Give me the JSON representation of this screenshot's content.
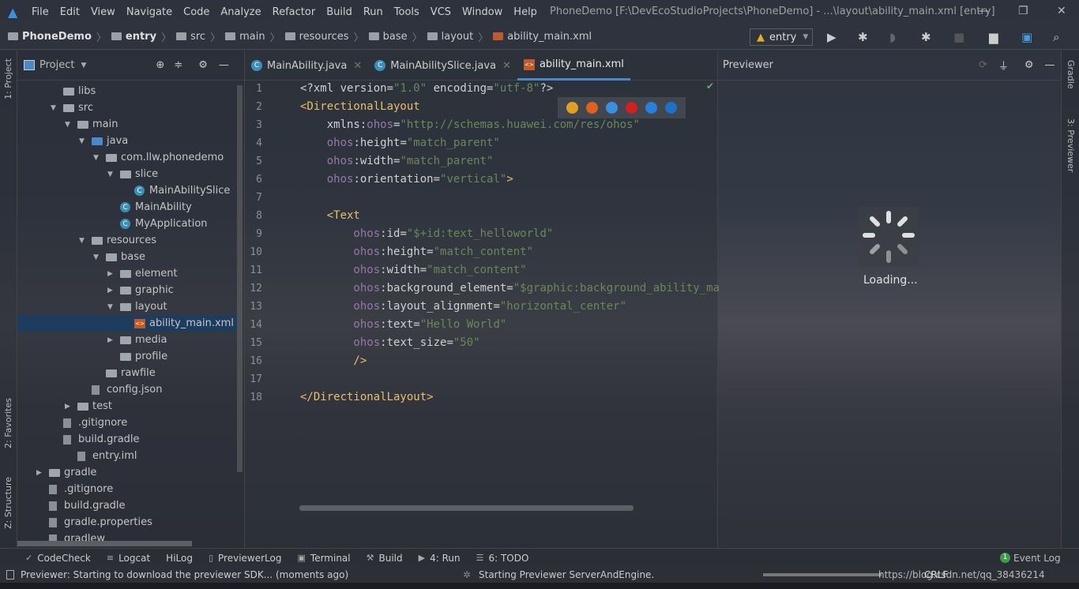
{
  "menu": {
    "items": [
      "File",
      "Edit",
      "View",
      "Navigate",
      "Code",
      "Analyze",
      "Refactor",
      "Build",
      "Run",
      "Tools",
      "VCS",
      "Window",
      "Help"
    ],
    "window_title": "PhoneDemo [F:\\DevEcoStudioProjects\\PhoneDemo] - ...\\layout\\ability_main.xml [entry]"
  },
  "breadcrumb": [
    "PhoneDemo",
    "entry",
    "src",
    "main",
    "resources",
    "base",
    "layout",
    "ability_main.xml"
  ],
  "toolbar": {
    "run_config": "entry"
  },
  "left_strip": {
    "project": "1: Project",
    "favorites": "2: Favorites",
    "structure": "Z: Structure"
  },
  "right_strip": {
    "gradle": "Gradle",
    "previewer": "3: Previewer"
  },
  "project_panel": {
    "title": "Project",
    "tree": [
      {
        "label": "libs",
        "indent": 80,
        "arrow": "",
        "icon": "folder"
      },
      {
        "label": "src",
        "indent": 80,
        "arrow": "down",
        "icon": "folder"
      },
      {
        "label": "main",
        "indent": 98,
        "arrow": "down",
        "icon": "folder"
      },
      {
        "label": "java",
        "indent": 116,
        "arrow": "down",
        "icon": "folder-blue"
      },
      {
        "label": "com.llw.phonedemo",
        "indent": 134,
        "arrow": "down",
        "icon": "folder"
      },
      {
        "label": "slice",
        "indent": 152,
        "arrow": "down",
        "icon": "folder"
      },
      {
        "label": "MainAbilitySlice",
        "indent": 170,
        "arrow": "",
        "icon": "class"
      },
      {
        "label": "MainAbility",
        "indent": 152,
        "arrow": "",
        "icon": "class"
      },
      {
        "label": "MyApplication",
        "indent": 152,
        "arrow": "",
        "icon": "class"
      },
      {
        "label": "resources",
        "indent": 116,
        "arrow": "down",
        "icon": "folder"
      },
      {
        "label": "base",
        "indent": 134,
        "arrow": "down",
        "icon": "folder"
      },
      {
        "label": "element",
        "indent": 152,
        "arrow": "right",
        "icon": "folder"
      },
      {
        "label": "graphic",
        "indent": 152,
        "arrow": "right",
        "icon": "folder"
      },
      {
        "label": "layout",
        "indent": 152,
        "arrow": "down",
        "icon": "folder"
      },
      {
        "label": "ability_main.xml",
        "indent": 170,
        "arrow": "",
        "icon": "xml",
        "selected": true
      },
      {
        "label": "media",
        "indent": 152,
        "arrow": "right",
        "icon": "folder"
      },
      {
        "label": "profile",
        "indent": 152,
        "arrow": "",
        "icon": "folder"
      },
      {
        "label": "rawfile",
        "indent": 134,
        "arrow": "",
        "icon": "folder"
      },
      {
        "label": "config.json",
        "indent": 116,
        "arrow": "",
        "icon": "file"
      },
      {
        "label": "test",
        "indent": 98,
        "arrow": "right",
        "icon": "folder"
      },
      {
        "label": ".gitignore",
        "indent": 80,
        "arrow": "",
        "icon": "file"
      },
      {
        "label": "build.gradle",
        "indent": 80,
        "arrow": "",
        "icon": "gradle"
      },
      {
        "label": "entry.iml",
        "indent": 98,
        "arrow": "",
        "icon": "file"
      },
      {
        "label": "gradle",
        "indent": 62,
        "arrow": "right",
        "icon": "folder"
      },
      {
        "label": ".gitignore",
        "indent": 62,
        "arrow": "",
        "icon": "file"
      },
      {
        "label": "build.gradle",
        "indent": 62,
        "arrow": "",
        "icon": "gradle"
      },
      {
        "label": "gradle.properties",
        "indent": 62,
        "arrow": "",
        "icon": "file"
      },
      {
        "label": "gradlew",
        "indent": 62,
        "arrow": "",
        "icon": "file"
      }
    ]
  },
  "editor": {
    "tabs": [
      {
        "label": "MainAbility.java",
        "icon": "class"
      },
      {
        "label": "MainAbilitySlice.java",
        "icon": "class"
      },
      {
        "label": "ability_main.xml",
        "icon": "xml",
        "active": true
      }
    ],
    "lines": [
      [
        [
          "pi",
          "<?xml version="
        ],
        [
          "val",
          "\"1.0\""
        ],
        [
          "pi",
          " encoding="
        ],
        [
          "val",
          "\"utf-8\""
        ],
        [
          "pi",
          "?>"
        ]
      ],
      [
        [
          "tag",
          "<DirectionalLayout"
        ]
      ],
      [
        [
          "at",
          "    xmlns:"
        ],
        [
          "ns",
          "ohos"
        ],
        [
          "at",
          "="
        ],
        [
          "val",
          "\"http://schemas.huawei.com/res/ohos\""
        ]
      ],
      [
        [
          "ns",
          "    ohos"
        ],
        [
          "at",
          ":height="
        ],
        [
          "val",
          "\"match_parent\""
        ]
      ],
      [
        [
          "ns",
          "    ohos"
        ],
        [
          "at",
          ":width="
        ],
        [
          "val",
          "\"match_parent\""
        ]
      ],
      [
        [
          "ns",
          "    ohos"
        ],
        [
          "at",
          ":orientation="
        ],
        [
          "val",
          "\"vertical\""
        ],
        [
          "tag",
          ">"
        ]
      ],
      [],
      [
        [
          "tag",
          "    <Text"
        ]
      ],
      [
        [
          "ns",
          "        ohos"
        ],
        [
          "at",
          ":id="
        ],
        [
          "val",
          "\"$+id:text_helloworld\""
        ]
      ],
      [
        [
          "ns",
          "        ohos"
        ],
        [
          "at",
          ":height="
        ],
        [
          "val",
          "\"match_content\""
        ]
      ],
      [
        [
          "ns",
          "        ohos"
        ],
        [
          "at",
          ":width="
        ],
        [
          "val",
          "\"match_content\""
        ]
      ],
      [
        [
          "ns",
          "        ohos"
        ],
        [
          "at",
          ":background_element="
        ],
        [
          "val",
          "\"$graphic:background_ability_main\""
        ]
      ],
      [
        [
          "ns",
          "        ohos"
        ],
        [
          "at",
          ":layout_alignment="
        ],
        [
          "val",
          "\"horizontal_center\""
        ]
      ],
      [
        [
          "ns",
          "        ohos"
        ],
        [
          "at",
          ":text="
        ],
        [
          "val",
          "\"Hello World\""
        ]
      ],
      [
        [
          "ns",
          "        ohos"
        ],
        [
          "at",
          ":text_size="
        ],
        [
          "val",
          "\"50\""
        ]
      ],
      [
        [
          "tag",
          "        />"
        ]
      ],
      [],
      [
        [
          "tag",
          "</DirectionalLayout>"
        ]
      ]
    ]
  },
  "previewer": {
    "title": "Previewer",
    "loading": "Loading..."
  },
  "bottom_tools": [
    {
      "label": "CodeCheck",
      "icon": "codecheck-icon"
    },
    {
      "label": "Logcat",
      "icon": "logcat-icon"
    },
    {
      "label": "HiLog",
      "icon": ""
    },
    {
      "label": "PreviewerLog",
      "icon": "log-icon"
    },
    {
      "label": "Terminal",
      "icon": "terminal-icon"
    },
    {
      "label": "Build",
      "icon": "hammer-icon"
    },
    {
      "label": "4: Run",
      "icon": "play-icon"
    },
    {
      "label": "6: TODO",
      "icon": "list-icon"
    }
  ],
  "event_log": {
    "label": "Event Log",
    "count": "1"
  },
  "status": {
    "message": "Previewer: Starting to download the previewer SDK... (moments ago)",
    "task": "Starting Previewer ServerAndEngine.",
    "watermark": "https://blog.csdn.net/qq_38436214",
    "encoding": "CRLF"
  },
  "colors": {
    "accent": "#4a88c7",
    "selection": "#1d3c5e",
    "tag": "#e8bf6a",
    "namespace": "#9876aa",
    "value": "#6a8759"
  }
}
